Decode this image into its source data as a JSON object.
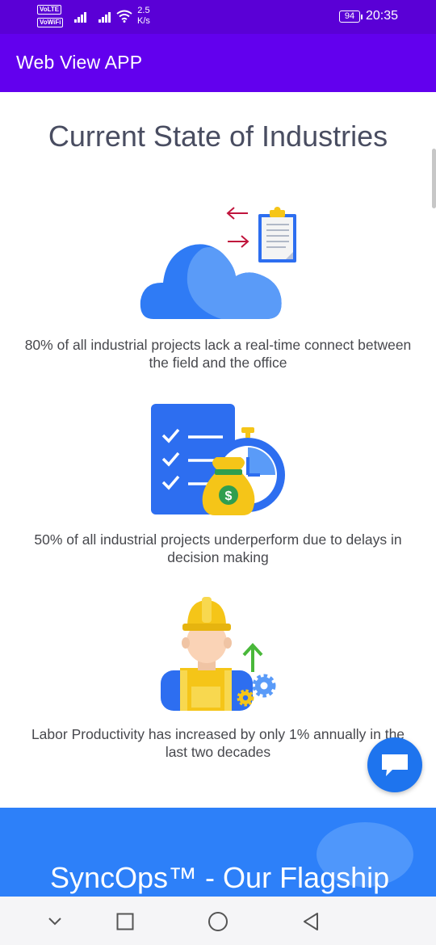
{
  "status_bar": {
    "volte_badge": "VoLTE",
    "vowifi_badge": "VoWiFi",
    "net_speed_value": "2.5",
    "net_speed_unit": "K/s",
    "battery": "94",
    "time": "20:35",
    "icons": [
      "signal-icon",
      "wifi-icon",
      "battery-icon"
    ]
  },
  "app_bar": {
    "title": "Web View APP"
  },
  "page": {
    "title": "Current State of Industries",
    "stats": [
      {
        "text": "80% of all industrial projects lack a real-time connect between the field and the office",
        "icon": "cloud-clipboard-icon"
      },
      {
        "text": "50% of all industrial projects underperform due to delays in decision making",
        "icon": "checklist-money-clock-icon"
      },
      {
        "text": "Labor Productivity has increased by only 1% annually in the last two decades",
        "icon": "worker-productivity-icon"
      }
    ]
  },
  "banner": {
    "title": "SyncOps™ - Our Flagship"
  },
  "fab": {
    "icon": "chat-icon"
  },
  "nav_bar": {
    "icons": [
      "back-chevron-icon",
      "recents-square-icon",
      "home-circle-icon",
      "back-triangle-icon"
    ]
  },
  "colors": {
    "status_bar": "#5a00d6",
    "app_bar": "#6200ee",
    "accent_blue": "#2d80f9",
    "text_dark": "#494d61"
  }
}
